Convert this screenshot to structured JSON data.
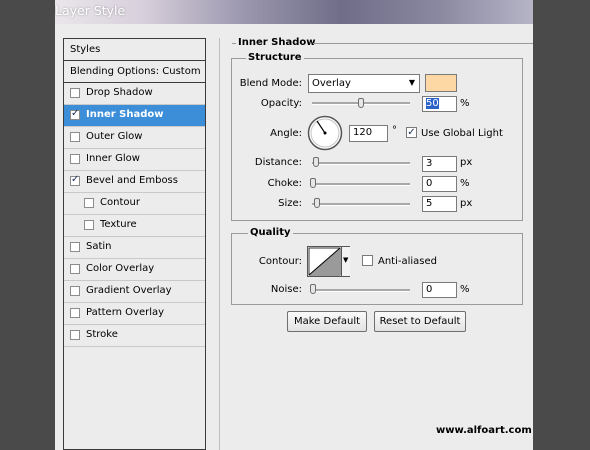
{
  "window": {
    "title": "Layer Style"
  },
  "styles_list": {
    "header": "Styles",
    "blending": "Blending Options: Custom",
    "items": [
      {
        "label": "Drop Shadow",
        "checked": false,
        "indent": false,
        "selected": false
      },
      {
        "label": "Inner Shadow",
        "checked": true,
        "indent": false,
        "selected": true
      },
      {
        "label": "Outer Glow",
        "checked": false,
        "indent": false,
        "selected": false
      },
      {
        "label": "Inner Glow",
        "checked": false,
        "indent": false,
        "selected": false
      },
      {
        "label": "Bevel and Emboss",
        "checked": true,
        "indent": false,
        "selected": false
      },
      {
        "label": "Contour",
        "checked": false,
        "indent": true,
        "selected": false
      },
      {
        "label": "Texture",
        "checked": false,
        "indent": true,
        "selected": false
      },
      {
        "label": "Satin",
        "checked": false,
        "indent": false,
        "selected": false
      },
      {
        "label": "Color Overlay",
        "checked": false,
        "indent": false,
        "selected": false
      },
      {
        "label": "Gradient Overlay",
        "checked": false,
        "indent": false,
        "selected": false
      },
      {
        "label": "Pattern Overlay",
        "checked": false,
        "indent": false,
        "selected": false
      },
      {
        "label": "Stroke",
        "checked": false,
        "indent": false,
        "selected": false
      }
    ]
  },
  "panel": {
    "title": "Inner Shadow",
    "structure": {
      "title": "Structure",
      "blend_mode_label": "Blend Mode:",
      "blend_mode_value": "Overlay",
      "color_swatch": "#fdd8a4",
      "opacity_label": "Opacity:",
      "opacity_value": "50",
      "opacity_unit": "%",
      "opacity_level": 0.5,
      "angle_label": "Angle:",
      "angle_value": "120",
      "angle_unit": "°",
      "use_global_light_label": "Use Global Light",
      "use_global_light_checked": true,
      "distance_label": "Distance:",
      "distance_value": "3",
      "distance_unit": "px",
      "choke_label": "Choke:",
      "choke_value": "0",
      "choke_unit": "%",
      "size_label": "Size:",
      "size_value": "5",
      "size_unit": "px"
    },
    "quality": {
      "title": "Quality",
      "contour_label": "Contour:",
      "anti_aliased_label": "Anti-aliased",
      "anti_aliased_checked": false,
      "noise_label": "Noise:",
      "noise_value": "0",
      "noise_unit": "%"
    },
    "buttons": {
      "make_default": "Make Default",
      "reset_default": "Reset to Default"
    }
  },
  "watermark": "www.alfoart.com",
  "colors": {
    "selection": "#3c8ed8",
    "swatch": "#fdd8a4"
  }
}
